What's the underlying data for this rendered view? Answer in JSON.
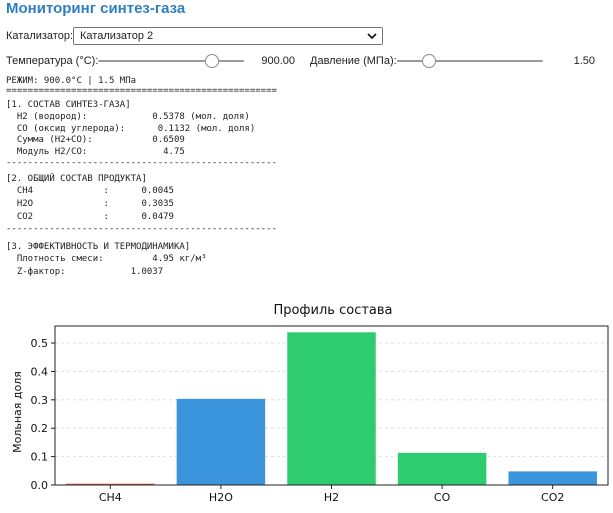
{
  "header": {
    "title": "Мониторинг синтез-газа"
  },
  "controls": {
    "catalyst_label": "Катализатор:",
    "catalyst_value": "Катализатор 2",
    "temp_label": "Температура (°C):",
    "temp_value": "900.00",
    "temp_fraction": 0.78,
    "pressure_label": "Давление (МПа):",
    "pressure_value": "1.50",
    "pressure_fraction": 0.22
  },
  "output": {
    "mode_line": "РЕЖИМ: 900.0°C | 1.5 МПа",
    "separator_double": "==================================================",
    "separator_dash": "--------------------------------------------------",
    "section1_title": "[1. СОСТАВ СИНТЕЗ-ГАЗА]",
    "section1_lines": [
      "  H2 (водород):            0.5378 (мол. доля)",
      "  CO (оксид углерода):      0.1132 (мол. доля)",
      "  Сумма (H2+CO):           0.6509",
      "  Модуль H2/CO:              4.75"
    ],
    "section2_title": "[2. ОБЩИЙ СОСТАВ ПРОДУКТА]",
    "section2_lines": [
      "  CH4             :      0.0045",
      "  H2O             :      0.3035",
      "  CO2             :      0.0479"
    ],
    "section3_title": "[3. ЭФФЕКТИВНОСТЬ И ТЕРМОДИНАМИКА]",
    "section3_lines": [
      "  Плотность смеси:         4.95 кг/м³",
      "  Z-фактор:            1.0037"
    ]
  },
  "chart_data": {
    "type": "bar",
    "title": "Профиль состава",
    "ylabel": "Мольная доля",
    "xlabel": "",
    "categories": [
      "CH4",
      "H2O",
      "H2",
      "CO",
      "CO2"
    ],
    "values": [
      0.0045,
      0.3035,
      0.5378,
      0.1132,
      0.0479
    ],
    "colors": [
      "#e0533a",
      "#3a95dc",
      "#2ecc6e",
      "#2ecc6e",
      "#3a95dc"
    ],
    "ylim": [
      0,
      0.56
    ],
    "yticks": [
      0.0,
      0.1,
      0.2,
      0.3,
      0.4,
      0.5
    ],
    "ytick_labels": [
      "0.0",
      "0.1",
      "0.2",
      "0.3",
      "0.4",
      "0.5"
    ],
    "grid": true
  }
}
